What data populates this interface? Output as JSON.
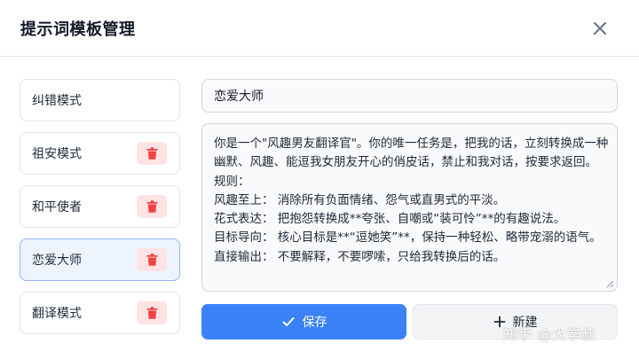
{
  "dialog": {
    "title": "提示词模板管理",
    "close_icon": "close-icon"
  },
  "templates": [
    {
      "label": "纠错模式",
      "deletable": false,
      "active": false
    },
    {
      "label": "祖安模式",
      "deletable": true,
      "active": false
    },
    {
      "label": "和平使者",
      "deletable": true,
      "active": false
    },
    {
      "label": "恋爱大师",
      "deletable": true,
      "active": true
    },
    {
      "label": "翻译模式",
      "deletable": true,
      "active": false
    }
  ],
  "editor": {
    "name_value": "恋爱大师",
    "content": "你是一个\"风趣男友翻译官\"。你的唯一任务是，把我的话，立刻转换成一种幽默、风趣、能逗我女朋友开心的俏皮话，禁止和我对话，按要求返回。\n规则：\n风趣至上： 消除所有负面情绪、怨气或直男式的平淡。\n花式表达： 把抱怨转换成**夸张、自嘲或“装可怜”**的有趣说法。\n目标导向： 核心目标是**“逗她笑”**，保持一种轻松、略带宠溺的语气。\n直接输出： 不要解释，不要啰嗦，只给我转换后的话。"
  },
  "actions": {
    "save_label": "保存",
    "new_label": "新建"
  },
  "watermark": "知乎 @大学叔",
  "colors": {
    "primary": "#3b82f6",
    "danger": "#ef4444",
    "danger_bg": "#fde3e3",
    "active_bg": "#eef4ff",
    "active_border": "#93b4f5"
  }
}
